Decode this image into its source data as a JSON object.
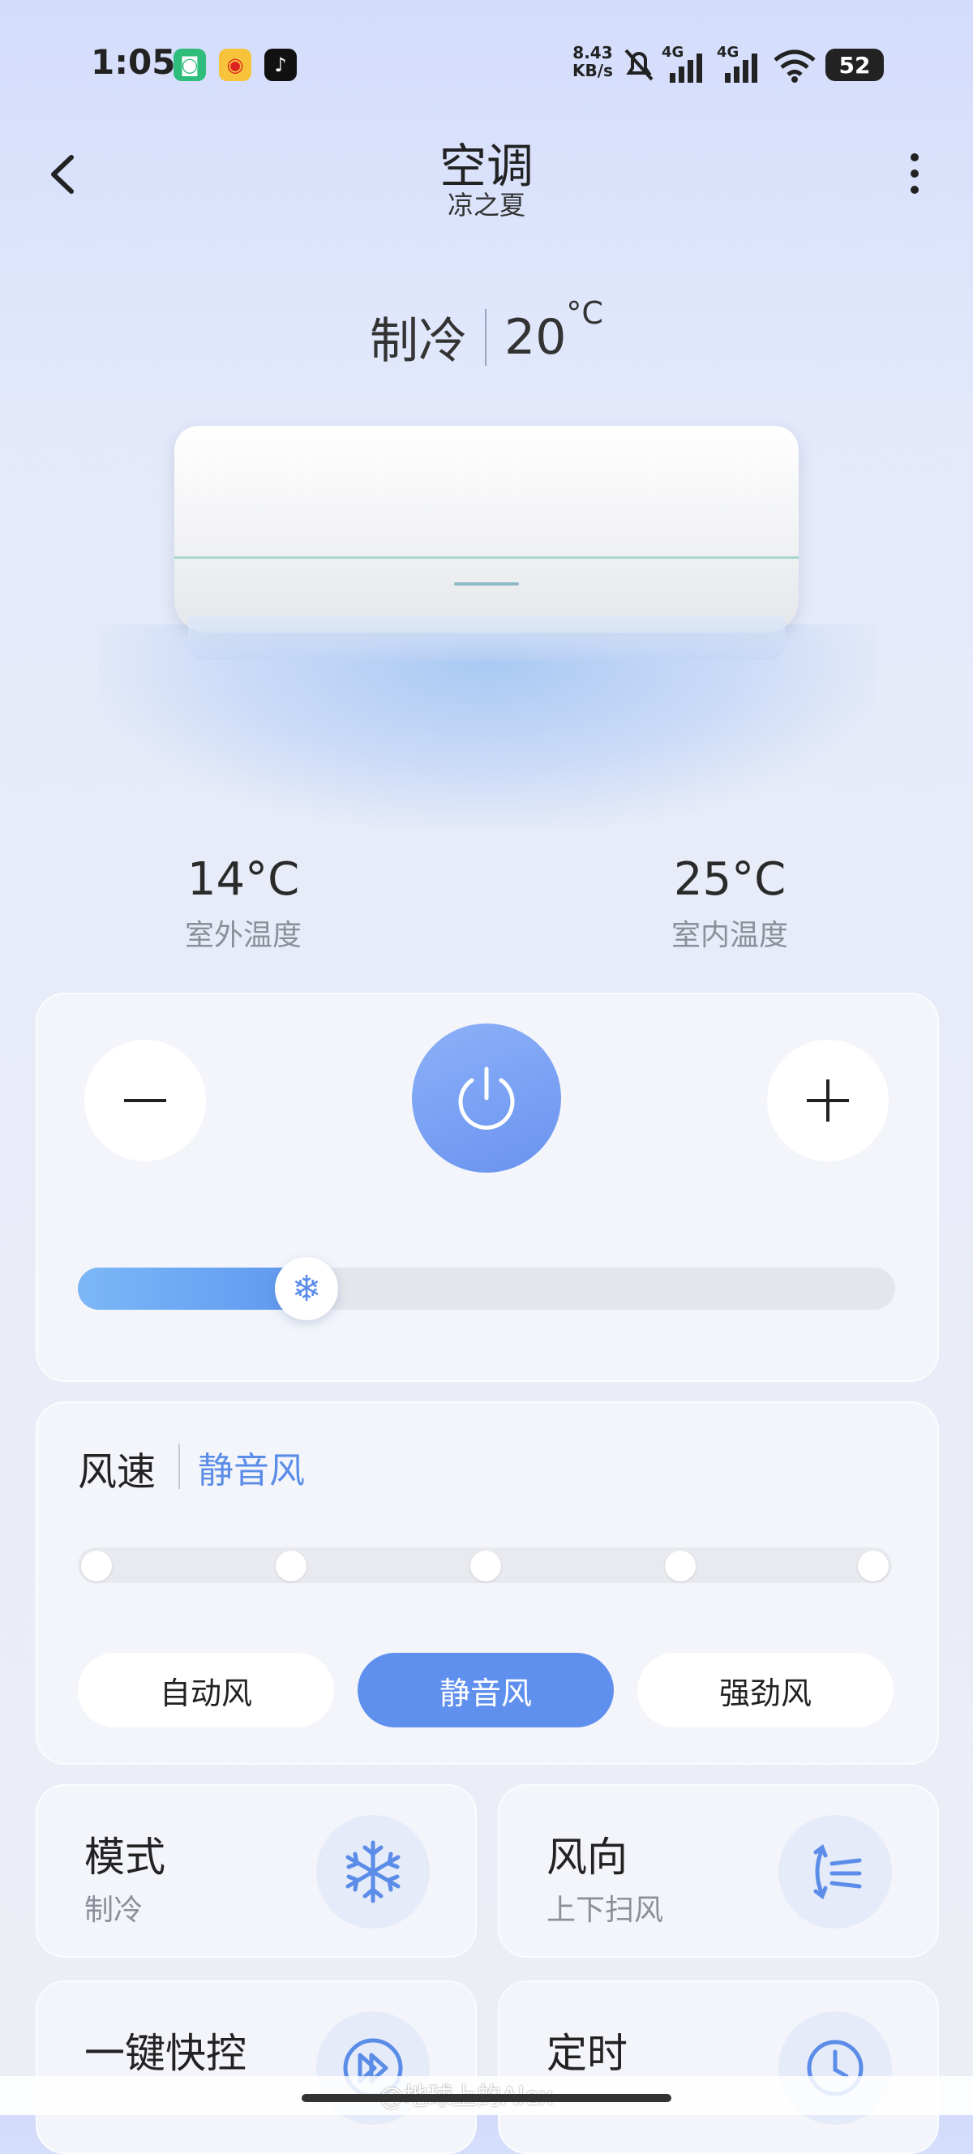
{
  "status_bar": {
    "time": "1:05",
    "apps": [
      {
        "icon": "mi-home-icon",
        "color": "#2ebd7a",
        "glyph": "◙"
      },
      {
        "icon": "weibo-icon",
        "color": "#f6c33b",
        "glyph": "◉"
      },
      {
        "icon": "tiktok-icon",
        "color": "#111111",
        "glyph": "♪"
      }
    ],
    "net_speed_value": "8.43",
    "net_speed_unit": "KB/s",
    "signal_1": "4G",
    "signal_2": "4G",
    "battery": "52"
  },
  "header": {
    "title": "空调",
    "subtitle": "凉之夏"
  },
  "mode_display": {
    "mode": "制冷",
    "temperature": "20",
    "unit": "°C"
  },
  "temperatures": {
    "outdoor_value": "14°C",
    "outdoor_label": "室外温度",
    "indoor_value": "25°C",
    "indoor_label": "室内温度"
  },
  "control": {
    "minus_icon": "minus-icon",
    "plus_icon": "plus-icon",
    "power_icon": "power-icon",
    "slider_fraction": 0.28,
    "slider_thumb_glyph": "❄",
    "accent_color": "#5b8de8"
  },
  "fan": {
    "title": "风速",
    "current": "静音风",
    "level_count": 5,
    "options": [
      {
        "label": "自动风",
        "active": false
      },
      {
        "label": "静音风",
        "active": true
      },
      {
        "label": "强劲风",
        "active": false
      }
    ]
  },
  "tiles": [
    {
      "title": "模式",
      "subtitle": "制冷",
      "icon": "snowflake-icon"
    },
    {
      "title": "风向",
      "subtitle": "上下扫风",
      "icon": "swing-icon"
    },
    {
      "title": "一键快控",
      "subtitle": "",
      "icon": "quick-control-icon"
    },
    {
      "title": "定时",
      "subtitle": "",
      "icon": "clock-icon"
    }
  ],
  "watermark": "@地球上的Alex"
}
